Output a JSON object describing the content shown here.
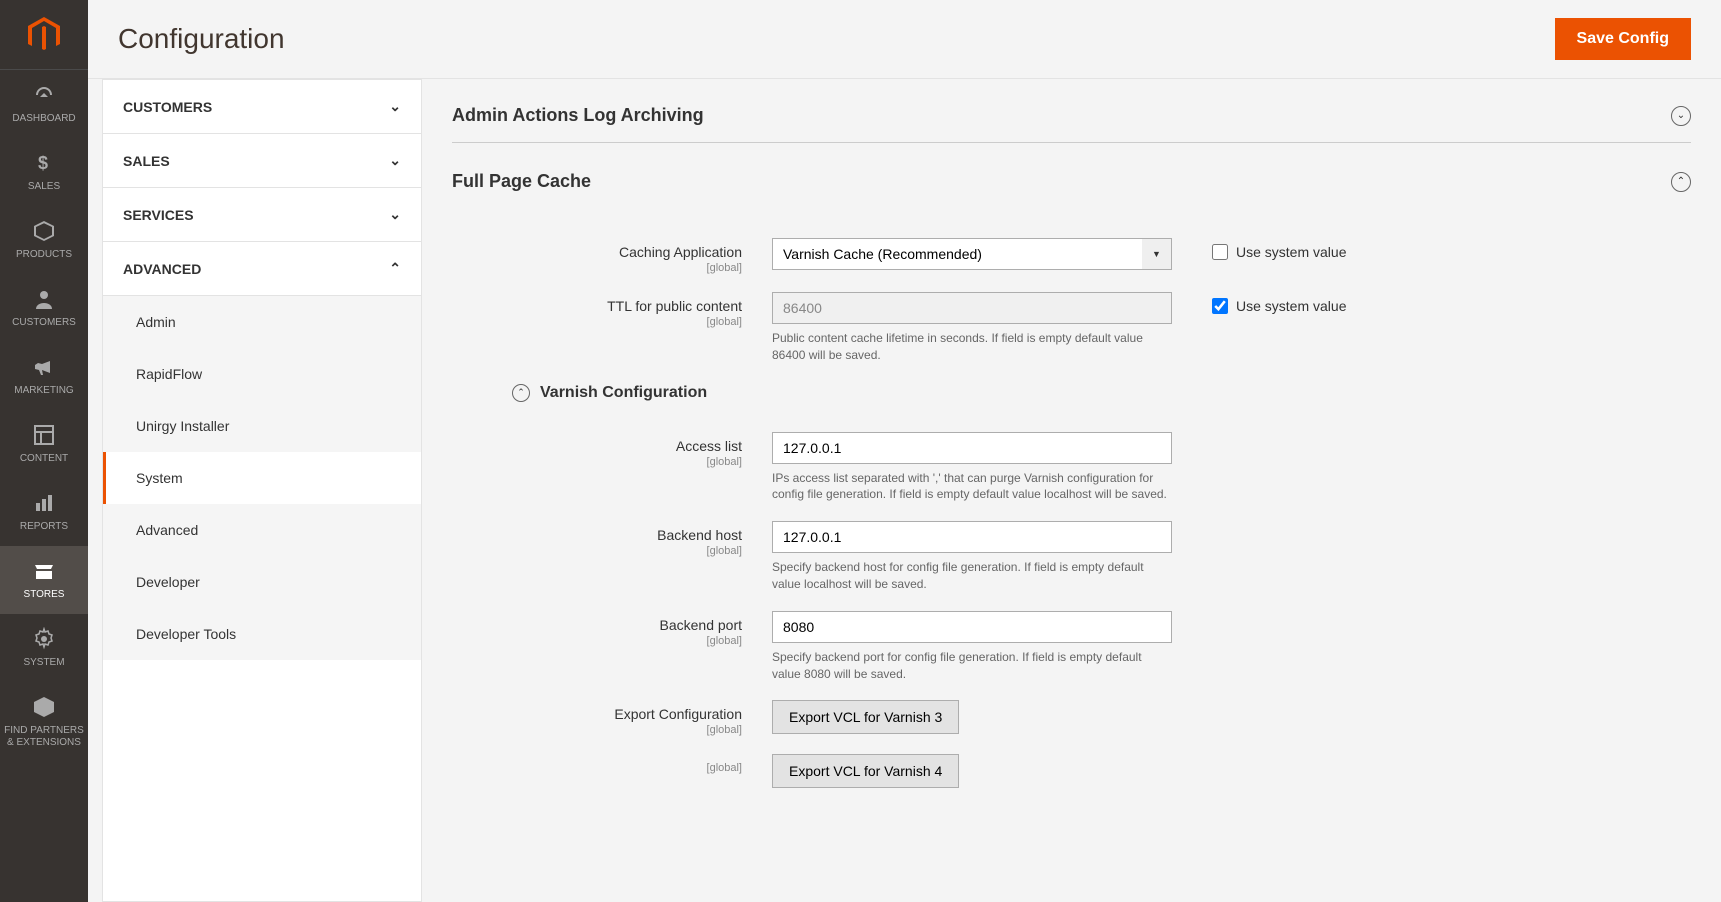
{
  "page": {
    "title": "Configuration",
    "save_button": "Save Config"
  },
  "sidebar": {
    "items": [
      {
        "label": "DASHBOARD"
      },
      {
        "label": "SALES"
      },
      {
        "label": "PRODUCTS"
      },
      {
        "label": "CUSTOMERS"
      },
      {
        "label": "MARKETING"
      },
      {
        "label": "CONTENT"
      },
      {
        "label": "REPORTS"
      },
      {
        "label": "STORES"
      },
      {
        "label": "SYSTEM"
      },
      {
        "label": "FIND PARTNERS & EXTENSIONS"
      }
    ]
  },
  "config_nav": {
    "sections": [
      {
        "label": "CUSTOMERS"
      },
      {
        "label": "SALES"
      },
      {
        "label": "SERVICES"
      },
      {
        "label": "ADVANCED"
      }
    ],
    "advanced_items": [
      {
        "label": "Admin"
      },
      {
        "label": "RapidFlow"
      },
      {
        "label": "Unirgy Installer"
      },
      {
        "label": "System"
      },
      {
        "label": "Advanced"
      },
      {
        "label": "Developer"
      },
      {
        "label": "Developer Tools"
      }
    ]
  },
  "sections": {
    "archiving": {
      "title": "Admin Actions Log Archiving"
    },
    "fpc": {
      "title": "Full Page Cache",
      "caching_app": {
        "label": "Caching Application",
        "scope": "[global]",
        "value": "Varnish Cache (Recommended)",
        "use_system": "Use system value"
      },
      "ttl": {
        "label": "TTL for public content",
        "scope": "[global]",
        "value": "86400",
        "note": "Public content cache lifetime in seconds. If field is empty default value 86400 will be saved.",
        "use_system": "Use system value"
      },
      "varnish": {
        "title": "Varnish Configuration",
        "access_list": {
          "label": "Access list",
          "scope": "[global]",
          "value": "127.0.0.1",
          "note": "IPs access list separated with ',' that can purge Varnish configuration for config file generation. If field is empty default value localhost will be saved."
        },
        "backend_host": {
          "label": "Backend host",
          "scope": "[global]",
          "value": "127.0.0.1",
          "note": "Specify backend host for config file generation. If field is empty default value localhost will be saved."
        },
        "backend_port": {
          "label": "Backend port",
          "scope": "[global]",
          "value": "8080",
          "note": "Specify backend port for config file generation. If field is empty default value 8080 will be saved."
        },
        "export": {
          "label": "Export Configuration",
          "scope": "[global]",
          "btn3": "Export VCL for Varnish 3",
          "btn4": "Export VCL for Varnish 4",
          "scope2": "[global]"
        }
      }
    }
  }
}
